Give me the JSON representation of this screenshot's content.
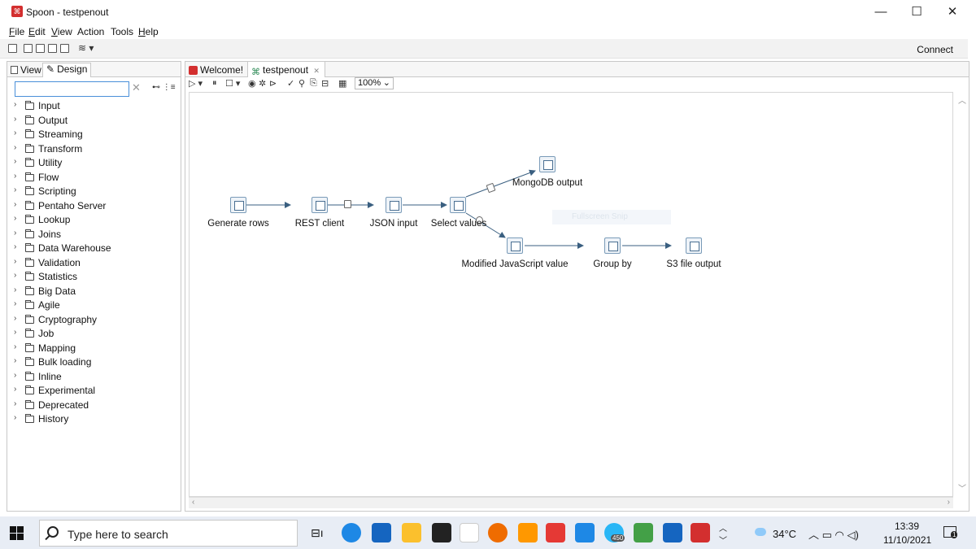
{
  "window": {
    "title": "Spoon - testpenout",
    "minimize": "—",
    "maximize": "☐",
    "close": "✕"
  },
  "menubar": [
    {
      "u": "F",
      "rest": "ile"
    },
    {
      "u": "E",
      "rest": "dit"
    },
    {
      "u": "V",
      "rest": "iew"
    },
    {
      "u": "",
      "rest": "Action"
    },
    {
      "u": "",
      "rest": "Tools"
    },
    {
      "u": "H",
      "rest": "elp"
    }
  ],
  "toolbar": {
    "connect_label": "Connect"
  },
  "left_panel": {
    "tab_view": "View",
    "tab_design": "Design",
    "search_value": "",
    "search_clear": "✕",
    "categories": [
      "Input",
      "Output",
      "Streaming",
      "Transform",
      "Utility",
      "Flow",
      "Scripting",
      "Pentaho Server",
      "Lookup",
      "Joins",
      "Data Warehouse",
      "Validation",
      "Statistics",
      "Big Data",
      "Agile",
      "Cryptography",
      "Job",
      "Mapping",
      "Bulk loading",
      "Inline",
      "Experimental",
      "Deprecated",
      "History"
    ]
  },
  "editor": {
    "tabs": [
      {
        "label": "Welcome!",
        "close": ""
      },
      {
        "label": "testpenout",
        "close": "✕"
      }
    ],
    "zoom": "100%",
    "steps": {
      "generate_rows": "Generate rows",
      "rest_client": "REST client",
      "json_input": "JSON input",
      "select_values": "Select values",
      "mongodb_output": "MongoDB output",
      "modified_js": "Modified JavaScript value",
      "group_by": "Group by",
      "s3_output": "S3 file output"
    },
    "watermark": "Fullscreen Snip"
  },
  "taskbar": {
    "search_placeholder": "Type here to search",
    "temperature": "34°C",
    "time": "13:39",
    "date": "11/10/2021",
    "badge_count": "450",
    "notif_count": "1"
  },
  "colors": {
    "accent": "#4a90d9",
    "spoon_red": "#d32f2f",
    "hop_line": "#3a5f80"
  }
}
